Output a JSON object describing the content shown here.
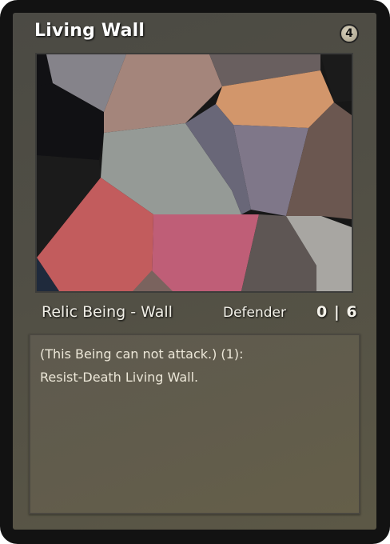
{
  "card": {
    "title": "Living Wall",
    "cost": "4",
    "type_line": "Relic Being - Wall",
    "keyword": "Defender",
    "stats": "0 | 6",
    "rules_lines": [
      "(This Being can not attack.) (1):",
      "Resist-Death Living Wall."
    ]
  },
  "art": {
    "icon": "polygon-mosaic-illustration",
    "palette": [
      "#111114",
      "#85838a",
      "#a4857b",
      "#695f5f",
      "#d2966b",
      "#171717",
      "#959a96",
      "#696778",
      "#7f7789",
      "#6b5750",
      "#1b1b1b",
      "#c25c5d",
      "#bf5e77",
      "#5e5654",
      "#a8a6a2",
      "#1f2a3c",
      "#7a635e"
    ]
  }
}
